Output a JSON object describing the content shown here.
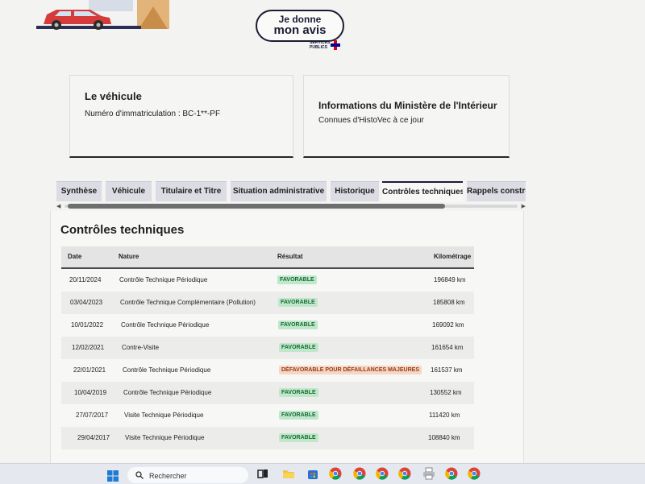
{
  "header": {
    "logo_line1": "Je donne",
    "logo_line2": "mon avis",
    "logo_sub1": "SERVICES",
    "logo_sub2": "PUBLICS"
  },
  "vehicle_card": {
    "title": "Le véhicule",
    "plate_text": "Numéro d'immatriculation : BC-1**-PF"
  },
  "ministry_card": {
    "title": "Informations du Ministère de l'Intérieur",
    "subtitle": "Connues d'HistoVec à ce jour"
  },
  "tabs": [
    {
      "label": "Synthèse",
      "active": false
    },
    {
      "label": "Véhicule",
      "active": false
    },
    {
      "label": "Titulaire et Titre",
      "active": false
    },
    {
      "label": "Situation administrative",
      "active": false
    },
    {
      "label": "Historique",
      "active": false
    },
    {
      "label": "Contrôles techniques",
      "active": true
    },
    {
      "label": "Rappels constructeur",
      "active": false
    }
  ],
  "section": {
    "title": "Contrôles techniques",
    "columns": {
      "date": "Date",
      "nature": "Nature",
      "result": "Résultat",
      "km": "Kilométrage"
    },
    "rows": [
      {
        "date": "20/11/2024",
        "nature": "Contrôle Technique Périodique",
        "result": "FAVORABLE",
        "status": "ok",
        "km": "196849 km"
      },
      {
        "date": "03/04/2023",
        "nature": "Contrôle Technique Complémentaire (Pollution)",
        "result": "FAVORABLE",
        "status": "ok",
        "km": "185808 km"
      },
      {
        "date": "10/01/2022",
        "nature": "Contrôle Technique Périodique",
        "result": "FAVORABLE",
        "status": "ok",
        "km": "169092 km"
      },
      {
        "date": "12/02/2021",
        "nature": "Contre-Visite",
        "result": "FAVORABLE",
        "status": "ok",
        "km": "161654 km"
      },
      {
        "date": "22/01/2021",
        "nature": "Contrôle Technique Périodique",
        "result": "DÉFAVORABLE POUR DÉFAILLANCES MAJEURES",
        "status": "ko",
        "km": "161537 km"
      },
      {
        "date": "10/04/2019",
        "nature": "Contrôle Technique Périodique",
        "result": "FAVORABLE",
        "status": "ok",
        "km": "130552 km"
      },
      {
        "date": "27/07/2017",
        "nature": "Visite Technique Périodique",
        "result": "FAVORABLE",
        "status": "ok",
        "km": "111420 km"
      },
      {
        "date": "29/04/2017",
        "nature": "Visite Technique Périodique",
        "result": "FAVORABLE",
        "status": "ok",
        "km": "108840 km"
      }
    ]
  },
  "taskbar": {
    "search_label": "Rechercher",
    "icons": [
      "windows-start-icon",
      "search-icon",
      "task-view-icon",
      "file-explorer-icon",
      "microsoft-store-icon",
      "chrome-icon",
      "chrome-profile-icon",
      "chrome-profile-icon",
      "chrome-profile-icon",
      "printer-icon",
      "chrome-profile-icon",
      "chrome-profile-icon"
    ]
  },
  "colors": {
    "brand_navy": "#1b1b35",
    "favorable_bg": "#bfe8cb",
    "favorable_text": "#1a6a34",
    "defavorable_bg": "#f4d7c6",
    "defavorable_text": "#9a3a10",
    "tab_bg": "#dcdce4"
  }
}
